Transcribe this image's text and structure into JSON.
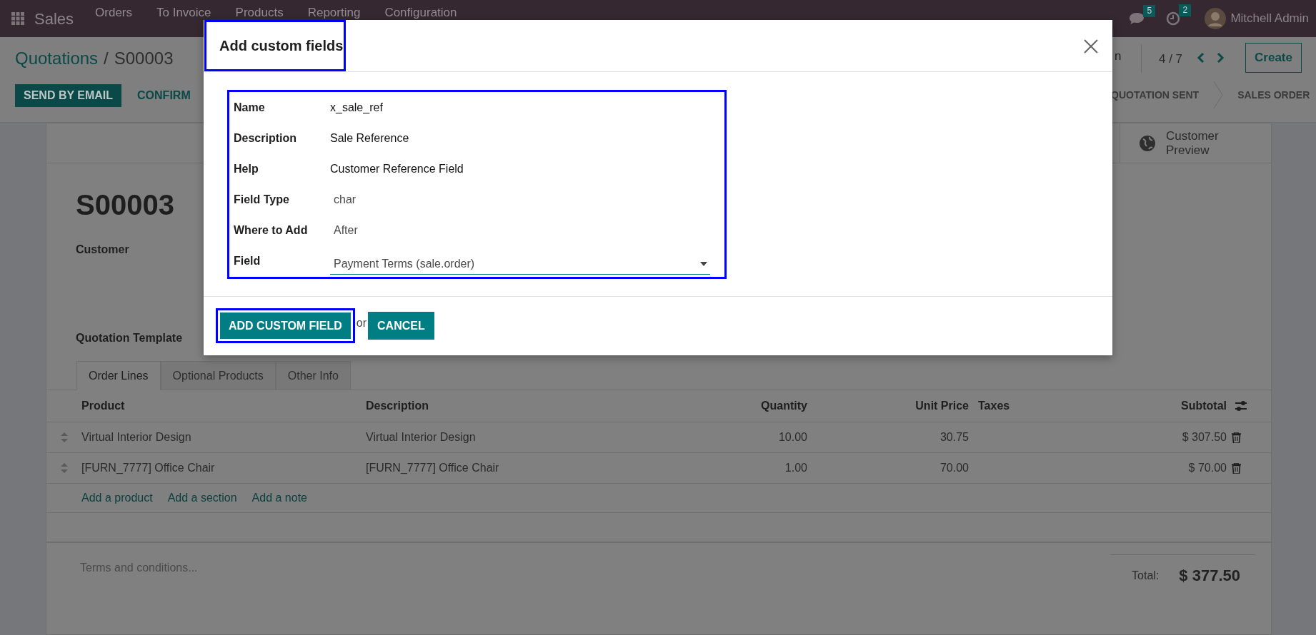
{
  "navbar": {
    "app": "Sales",
    "menu": [
      "Orders",
      "To Invoice",
      "Products",
      "Reporting",
      "Configuration"
    ],
    "messages_count": "5",
    "activities_count": "2",
    "user": "Mitchell Admin"
  },
  "control_panel": {
    "breadcrumb_parent": "Quotations",
    "breadcrumb_separator": "/",
    "breadcrumb_current": "S00003",
    "buttons": [
      {
        "label": "SEND BY EMAIL",
        "kind": "primary"
      },
      {
        "label": "CONFIRM",
        "kind": "secondary"
      }
    ],
    "partial_button_text": "n",
    "pager": "4 / 7",
    "create": "Create",
    "stages": [
      "QUOTATION SENT",
      "SALES ORDER"
    ]
  },
  "form": {
    "smart_button": "Customer Preview",
    "name": "S00003",
    "customer_label": "Customer",
    "template_label": "Quotation Template",
    "tabs": [
      {
        "label": "Order Lines",
        "selected": true
      },
      {
        "label": "Optional Products",
        "selected": false
      },
      {
        "label": "Other Info",
        "selected": false
      }
    ],
    "table": {
      "columns": [
        "Product",
        "Description",
        "Quantity",
        "Unit Price",
        "Taxes",
        "Subtotal"
      ],
      "rows": [
        [
          "Virtual Interior Design",
          "Virtual Interior Design",
          "10.00",
          "30.75",
          "",
          "$ 307.50"
        ],
        [
          "[FURN_7777] Office Chair",
          "[FURN_7777] Office Chair",
          "1.00",
          "70.00",
          "",
          "$ 70.00"
        ]
      ]
    },
    "add_links": [
      "Add a product",
      "Add a section",
      "Add a note"
    ],
    "terms_placeholder": "Terms and conditions...",
    "total_label": "Total:",
    "total": "$ 377.50"
  },
  "dialog": {
    "title": "Add custom fields",
    "fields": [
      {
        "label": "Name",
        "value": "x_sale_ref",
        "kind": "input"
      },
      {
        "label": "Description",
        "value": "Sale Reference",
        "kind": "input"
      },
      {
        "label": "Help",
        "value": "Customer Reference Field",
        "kind": "input"
      },
      {
        "label": "Field Type",
        "value": "char",
        "kind": "readonly"
      },
      {
        "label": "Where to Add",
        "value": "After",
        "kind": "readonly"
      },
      {
        "label": "Field",
        "value": "Payment Terms (sale.order)",
        "kind": "select"
      }
    ],
    "primary_button": "ADD CUSTOM FIELD",
    "or": "or",
    "cancel": "CANCEL"
  }
}
